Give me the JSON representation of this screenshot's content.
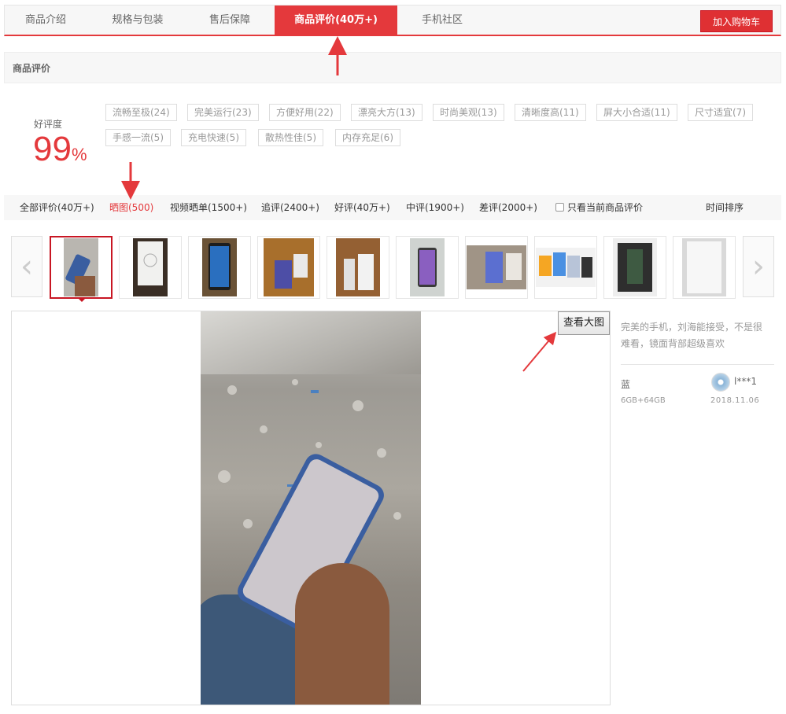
{
  "tabs": [
    {
      "label": "商品介绍"
    },
    {
      "label": "规格与包装"
    },
    {
      "label": "售后保障"
    },
    {
      "label": "商品评价(40万+)",
      "active": true
    },
    {
      "label": "手机社区"
    }
  ],
  "cart_button": "加入购物车",
  "section_title": "商品评价",
  "rating": {
    "label": "好评度",
    "value": "99",
    "unit": "%"
  },
  "tags": [
    "流畅至极(24)",
    "完美运行(23)",
    "方便好用(22)",
    "漂亮大方(13)",
    "时尚美观(13)",
    "清晰度高(11)",
    "屏大小合适(11)",
    "尺寸适宜(7)",
    "手感一流(5)",
    "充电快速(5)",
    "散热性佳(5)",
    "内存充足(6)"
  ],
  "filters": [
    "全部评价(40万+)",
    "晒图(500)",
    "视频晒单(1500+)",
    "追评(2400+)",
    "好评(40万+)",
    "中评(1900+)",
    "差评(2000+)"
  ],
  "active_filter_index": 1,
  "only_current": "只看当前商品评价",
  "sort": "时间排序",
  "view_big_button": "查看大图",
  "review": {
    "text": "完美的手机，刘海能接受，不是很难看，镜面背部超级喜欢",
    "color": "蓝",
    "spec": "6GB+64GB",
    "user": "l***1",
    "date": "2018.11.06"
  },
  "nav": {
    "prev_icon": "chevron-left-icon",
    "next_icon": "chevron-right-icon"
  },
  "colors": {
    "accent": "#e4393c"
  }
}
